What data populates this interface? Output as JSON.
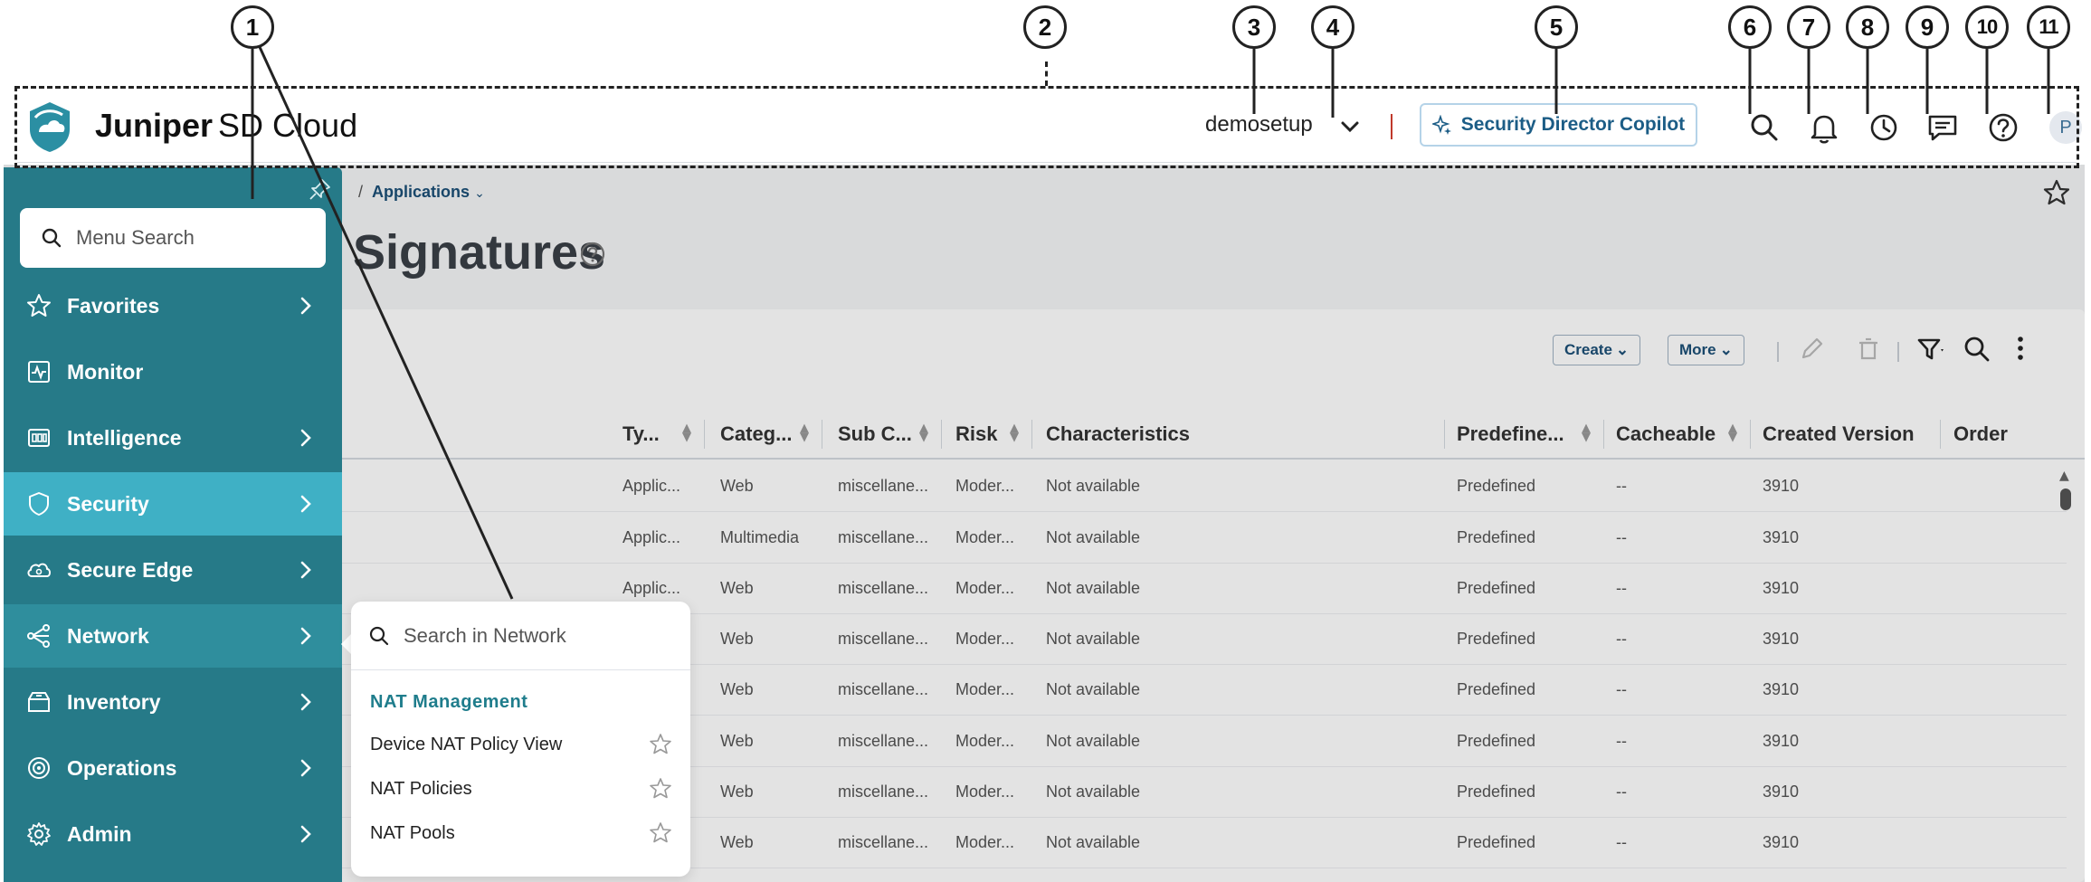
{
  "callouts": [
    "1",
    "2",
    "3",
    "4",
    "5",
    "6",
    "7",
    "8",
    "9",
    "10",
    "11"
  ],
  "header": {
    "brand_bold": "Juniper",
    "brand_rest": "SD Cloud",
    "tenant": "demosetup",
    "copilot_label": "Security Director Copilot",
    "avatar_initial": "P",
    "icons": [
      "search-icon",
      "bell-icon",
      "clock-icon",
      "feedback-icon",
      "help-icon",
      "avatar"
    ]
  },
  "breadcrumb": {
    "separator": "/",
    "current": "Applications"
  },
  "page": {
    "title": "Signatures"
  },
  "toolbar": {
    "create_label": "Create",
    "more_label": "More"
  },
  "table": {
    "columns": [
      "Ty...",
      "Categ...",
      "Sub C...",
      "Risk",
      "Characteristics",
      "Predefine...",
      "Cacheable",
      "Created Version",
      "Order"
    ],
    "rows": [
      [
        "Applic...",
        "Web",
        "miscellane...",
        "Moder...",
        "Not available",
        "Predefined",
        "--",
        "3910",
        ""
      ],
      [
        "Applic...",
        "Multimedia",
        "miscellane...",
        "Moder...",
        "Not available",
        "Predefined",
        "--",
        "3910",
        ""
      ],
      [
        "Applic...",
        "Web",
        "miscellane...",
        "Moder...",
        "Not available",
        "Predefined",
        "--",
        "3910",
        ""
      ],
      [
        "",
        "Web",
        "miscellane...",
        "Moder...",
        "Not available",
        "Predefined",
        "--",
        "3910",
        ""
      ],
      [
        "",
        "Web",
        "miscellane...",
        "Moder...",
        "Not available",
        "Predefined",
        "--",
        "3910",
        ""
      ],
      [
        "",
        "Web",
        "miscellane...",
        "Moder...",
        "Not available",
        "Predefined",
        "--",
        "3910",
        ""
      ],
      [
        "",
        "Web",
        "miscellane...",
        "Moder...",
        "Not available",
        "Predefined",
        "--",
        "3910",
        ""
      ],
      [
        "",
        "Web",
        "miscellane...",
        "Moder...",
        "Not available",
        "Predefined",
        "--",
        "3910",
        ""
      ]
    ]
  },
  "sidemenu": {
    "search_placeholder": "Menu Search",
    "items": [
      {
        "label": "Favorites",
        "icon": "star-icon"
      },
      {
        "label": "Monitor",
        "icon": "monitor-icon"
      },
      {
        "label": "Intelligence",
        "icon": "intelligence-icon"
      },
      {
        "label": "Security",
        "icon": "shield-icon"
      },
      {
        "label": "Secure Edge",
        "icon": "cloud-icon"
      },
      {
        "label": "Network",
        "icon": "network-icon"
      },
      {
        "label": "Inventory",
        "icon": "inventory-icon"
      },
      {
        "label": "Operations",
        "icon": "operations-icon"
      },
      {
        "label": "Admin",
        "icon": "gear-icon"
      }
    ]
  },
  "flyout": {
    "search_placeholder": "Search in Network",
    "group": "NAT Management",
    "items": [
      "Device NAT Policy View",
      "NAT Policies",
      "NAT Pools"
    ]
  },
  "colors": {
    "menu_bg": "#267a88",
    "menu_active": "#3fb0c5",
    "accent_text": "#1c5d86",
    "group_heading": "#1f7d8c"
  }
}
